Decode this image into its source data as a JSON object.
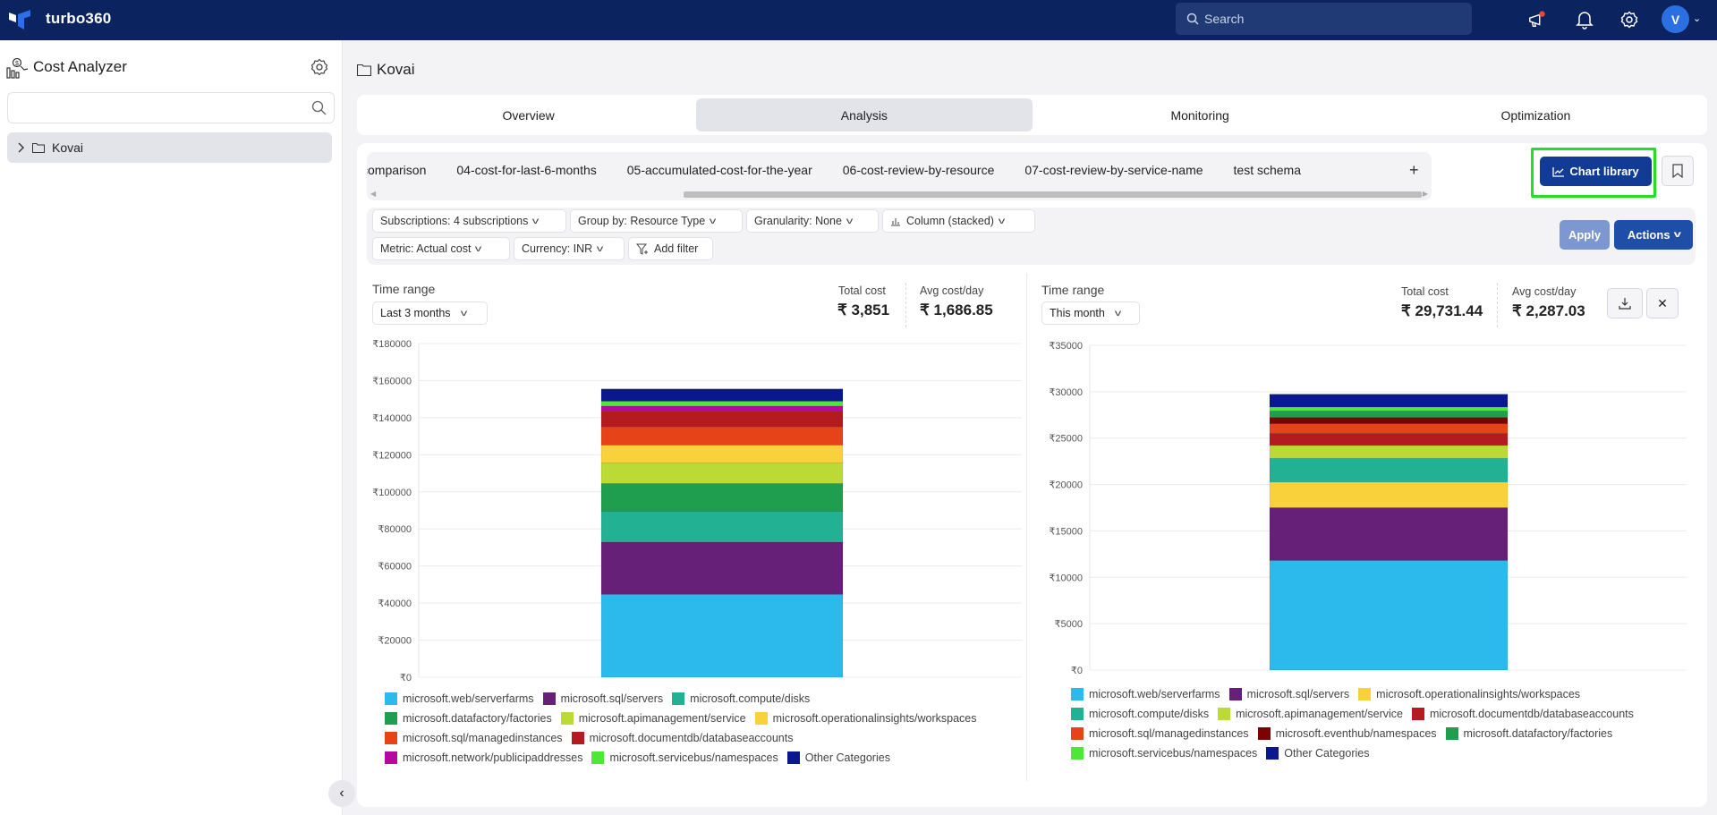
{
  "header": {
    "brand": "turbo360",
    "search_placeholder": "Search",
    "avatar_initial": "V",
    "icons": [
      "megaphone-icon",
      "bell-icon",
      "gear-icon"
    ]
  },
  "sidebar": {
    "title": "Cost Analyzer",
    "search_value": "",
    "tree": [
      {
        "label": "Kovai",
        "expanded": false
      }
    ]
  },
  "breadcrumb": {
    "label": "Kovai"
  },
  "nav_tabs": [
    {
      "label": "Overview",
      "active": false
    },
    {
      "label": "Analysis",
      "active": true
    },
    {
      "label": "Monitoring",
      "active": false
    },
    {
      "label": "Optimization",
      "active": false
    }
  ],
  "report_tabs": [
    "comparison",
    "04-cost-for-last-6-months",
    "05-accumulated-cost-for-the-year",
    "06-cost-review-by-resource",
    "07-cost-review-by-service-name",
    "test schema"
  ],
  "toolbar": {
    "add_tab": "+",
    "chart_library": "Chart library",
    "apply": "Apply",
    "actions": "Actions"
  },
  "filters": {
    "subscriptions": "Subscriptions: 4 subscriptions",
    "group_by": "Group by: Resource Type",
    "granularity": "Granularity: None",
    "chart_type": "Column (stacked)",
    "metric": "Metric: Actual cost",
    "currency": "Currency: INR",
    "add_filter": "Add filter"
  },
  "panels": [
    {
      "time_range_label": "Time range",
      "time_range": "Last 3 months",
      "total_cost_label": "Total cost",
      "total_cost": "₹ 3,851",
      "avg_cost_label": "Avg cost/day",
      "avg_cost": "₹ 1,686.85"
    },
    {
      "time_range_label": "Time range",
      "time_range": "This month",
      "total_cost_label": "Total cost",
      "total_cost": "₹ 29,731.44",
      "avg_cost_label": "Avg cost/day",
      "avg_cost": "₹ 2,287.03"
    }
  ],
  "chart_data": [
    {
      "type": "bar",
      "stacked": true,
      "title": "",
      "xlabel": "",
      "ylabel": "",
      "ylim": [
        0,
        180000
      ],
      "yticks": [
        0,
        20000,
        40000,
        60000,
        80000,
        100000,
        120000,
        140000,
        160000,
        180000
      ],
      "ytick_prefix": "₹",
      "grid": true,
      "legend": "bottom",
      "categories": [
        ""
      ],
      "series": [
        {
          "name": "microsoft.web/serverfarms",
          "color": "#2cb9ec",
          "values": [
            44700
          ]
        },
        {
          "name": "microsoft.sql/servers",
          "color": "#662077",
          "values": [
            28200
          ]
        },
        {
          "name": "microsoft.compute/disks",
          "color": "#22b193",
          "values": [
            16600
          ]
        },
        {
          "name": "microsoft.datafactory/factories",
          "color": "#1e9e4e",
          "values": [
            15000
          ]
        },
        {
          "name": "microsoft.apimanagement/service",
          "color": "#bbda35",
          "values": [
            11100
          ]
        },
        {
          "name": "microsoft.operationalinsights/workspaces",
          "color": "#f9d23b",
          "values": [
            9600
          ]
        },
        {
          "name": "microsoft.sql/managedinstances",
          "color": "#e64318",
          "values": [
            9800
          ]
        },
        {
          "name": "microsoft.documentdb/databaseaccounts",
          "color": "#b41b20",
          "values": [
            8700
          ]
        },
        {
          "name": "microsoft.network/publicipaddresses",
          "color": "#b5089e",
          "values": [
            2600
          ]
        },
        {
          "name": "microsoft.servicebus/namespaces",
          "color": "#4de835",
          "values": [
            2600
          ]
        },
        {
          "name": "Other Categories",
          "color": "#0b178f",
          "values": [
            6600
          ]
        }
      ]
    },
    {
      "type": "bar",
      "stacked": true,
      "title": "",
      "xlabel": "",
      "ylabel": "",
      "ylim": [
        0,
        35000
      ],
      "yticks": [
        0,
        5000,
        10000,
        15000,
        20000,
        25000,
        30000,
        35000
      ],
      "ytick_prefix": "₹",
      "grid": true,
      "legend": "bottom",
      "categories": [
        ""
      ],
      "series": [
        {
          "name": "microsoft.web/serverfarms",
          "color": "#2cb9ec",
          "values": [
            11816
          ]
        },
        {
          "name": "microsoft.sql/servers",
          "color": "#662077",
          "values": [
            5684
          ]
        },
        {
          "name": "microsoft.operationalinsights/workspaces",
          "color": "#f9d23b",
          "values": [
            2760
          ]
        },
        {
          "name": "microsoft.compute/disks",
          "color": "#22b193",
          "values": [
            2570
          ]
        },
        {
          "name": "microsoft.apimanagement/service",
          "color": "#bbda35",
          "values": [
            1380
          ]
        },
        {
          "name": "microsoft.documentdb/databaseaccounts",
          "color": "#b41b20",
          "values": [
            1320
          ]
        },
        {
          "name": "microsoft.sql/managedinstances",
          "color": "#e64318",
          "values": [
            1020
          ]
        },
        {
          "name": "microsoft.eventhub/namespaces",
          "color": "#7b0304",
          "values": [
            680
          ]
        },
        {
          "name": "microsoft.datafactory/factories",
          "color": "#1e9e4e",
          "values": [
            710
          ]
        },
        {
          "name": "microsoft.servicebus/namespaces",
          "color": "#4de835",
          "values": [
            410
          ]
        },
        {
          "name": "Other Categories",
          "color": "#0b178f",
          "values": [
            1381
          ]
        }
      ]
    }
  ]
}
